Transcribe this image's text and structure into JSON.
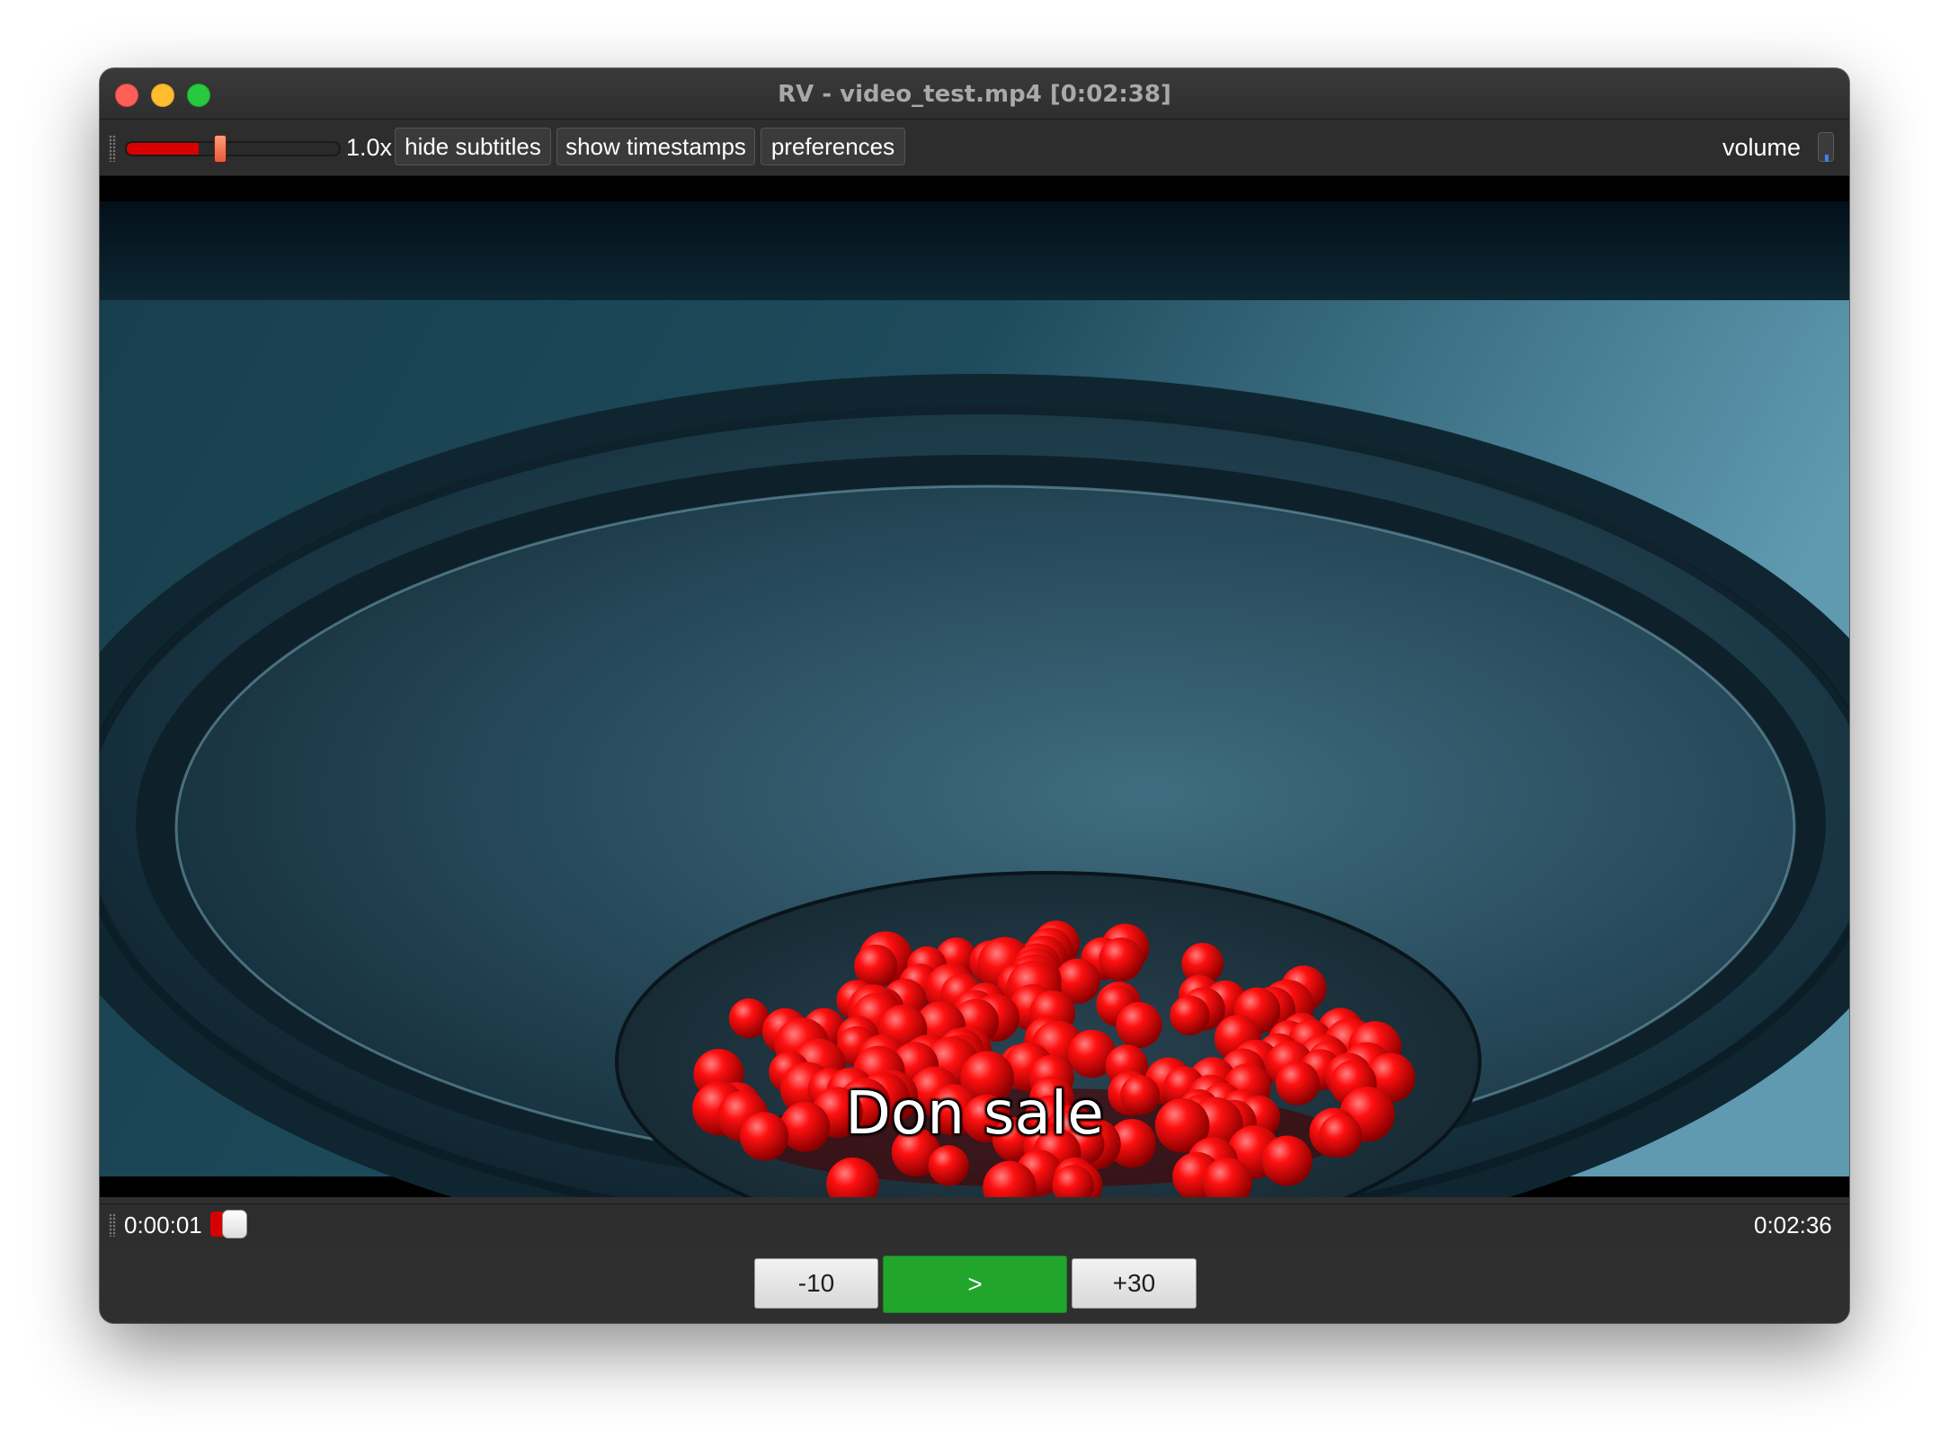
{
  "window": {
    "title": "RV - video_test.mp4 [0:02:38]"
  },
  "toolbar": {
    "speed_label": "1.0x",
    "speed_fraction": 0.34,
    "hide_subtitles_label": "hide subtitles",
    "show_timestamps_label": "show timestamps",
    "preferences_label": "preferences",
    "volume_label": "volume"
  },
  "video": {
    "subtitle": "Don sale"
  },
  "seekbar": {
    "current_time": "0:00:01",
    "total_time": "0:02:36"
  },
  "controls": {
    "back_label": "-10",
    "play_label": ">",
    "forward_label": "+30"
  },
  "colors": {
    "accent_red": "#d80000",
    "play_green": "#21a52b",
    "window_bg": "#2f2f2f"
  }
}
